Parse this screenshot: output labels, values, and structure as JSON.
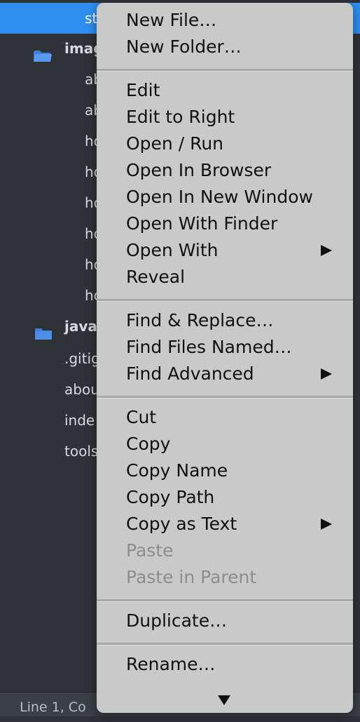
{
  "sidebar": {
    "selected_label": "st",
    "rows": [
      {
        "label": "imag",
        "kind": "folder"
      },
      {
        "label": "ab",
        "kind": "file"
      },
      {
        "label": "ab",
        "kind": "file"
      },
      {
        "label": "ho",
        "kind": "file"
      },
      {
        "label": "ho",
        "kind": "file"
      },
      {
        "label": "ho",
        "kind": "file"
      },
      {
        "label": "ho",
        "kind": "file"
      },
      {
        "label": "ho",
        "kind": "file"
      },
      {
        "label": "ho",
        "kind": "file"
      },
      {
        "label": "java",
        "kind": "folder"
      },
      {
        "label": ".gitig",
        "kind": "file"
      },
      {
        "label": "abou",
        "kind": "file"
      },
      {
        "label": "inde",
        "kind": "file"
      },
      {
        "label": "tools",
        "kind": "file"
      }
    ],
    "folder_icon_color": "#3d7fd9",
    "selection_color": "#2f8ff0"
  },
  "statusbar": {
    "text": "Line 1, Co"
  },
  "context_menu": {
    "groups": [
      [
        {
          "label": "New File…"
        },
        {
          "label": "New Folder…"
        }
      ],
      [
        {
          "label": "Edit"
        },
        {
          "label": "Edit to Right"
        },
        {
          "label": "Open / Run"
        },
        {
          "label": "Open In Browser"
        },
        {
          "label": "Open In New Window"
        },
        {
          "label": "Open With Finder"
        },
        {
          "label": "Open With",
          "submenu": true
        },
        {
          "label": "Reveal"
        }
      ],
      [
        {
          "label": "Find & Replace…"
        },
        {
          "label": "Find Files Named…"
        },
        {
          "label": "Find Advanced",
          "submenu": true
        }
      ],
      [
        {
          "label": "Cut"
        },
        {
          "label": "Copy"
        },
        {
          "label": "Copy Name"
        },
        {
          "label": "Copy Path"
        },
        {
          "label": "Copy as Text",
          "submenu": true
        },
        {
          "label": "Paste",
          "disabled": true
        },
        {
          "label": "Paste in Parent",
          "disabled": true
        }
      ],
      [
        {
          "label": "Duplicate…"
        }
      ],
      [
        {
          "label": "Rename…"
        }
      ]
    ],
    "scroll_indicator": "chevron-down-icon"
  }
}
